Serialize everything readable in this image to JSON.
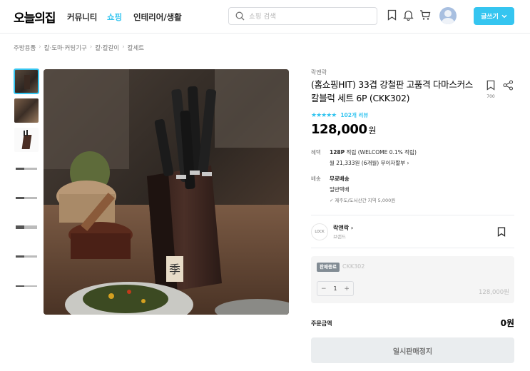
{
  "header": {
    "logo": "오늘의집",
    "nav": [
      {
        "label": "커뮤니티",
        "active": false
      },
      {
        "label": "쇼핑",
        "active": true
      },
      {
        "label": "인테리어/생활",
        "active": false
      }
    ],
    "search_placeholder": "쇼핑 검색",
    "write_button": "글쓰기"
  },
  "breadcrumb": [
    "주방용품",
    "칼·도마·커팅기구",
    "칼·칼갈이",
    "칼세트"
  ],
  "product": {
    "brand": "락앤락",
    "title": "(홈쇼핑HIT) 33겹 강철판 고품격 다마스커스 칼블럭 세트 6P (CKK302)",
    "scrap_count": "700",
    "rating_stars": 5,
    "review_label": "102개 리뷰",
    "price": "128,000",
    "price_unit": "원",
    "benefit_label": "혜택",
    "benefit_point": "128P",
    "benefit_point_text": "적립 (WELCOME 0.1% 적립)",
    "installment": "월 21,333원 (6개월) 무이자할부",
    "shipping_label": "배송",
    "shipping_fee": "무료배송",
    "shipping_type": "일반택배",
    "shipping_note": "제주도/도서산간 지역 5,000원"
  },
  "brand_card": {
    "name": "락앤락",
    "sub": "브랜드",
    "logo_text": "LOCK"
  },
  "option": {
    "badge": "판매종료",
    "name": "CKK302",
    "quantity": "1",
    "price": "128,000원"
  },
  "total": {
    "label": "주문금액",
    "value": "0원"
  },
  "buy_button": "일시판매정지",
  "colors": {
    "accent": "#35c5f0",
    "text": "#292929",
    "muted": "#757575"
  }
}
